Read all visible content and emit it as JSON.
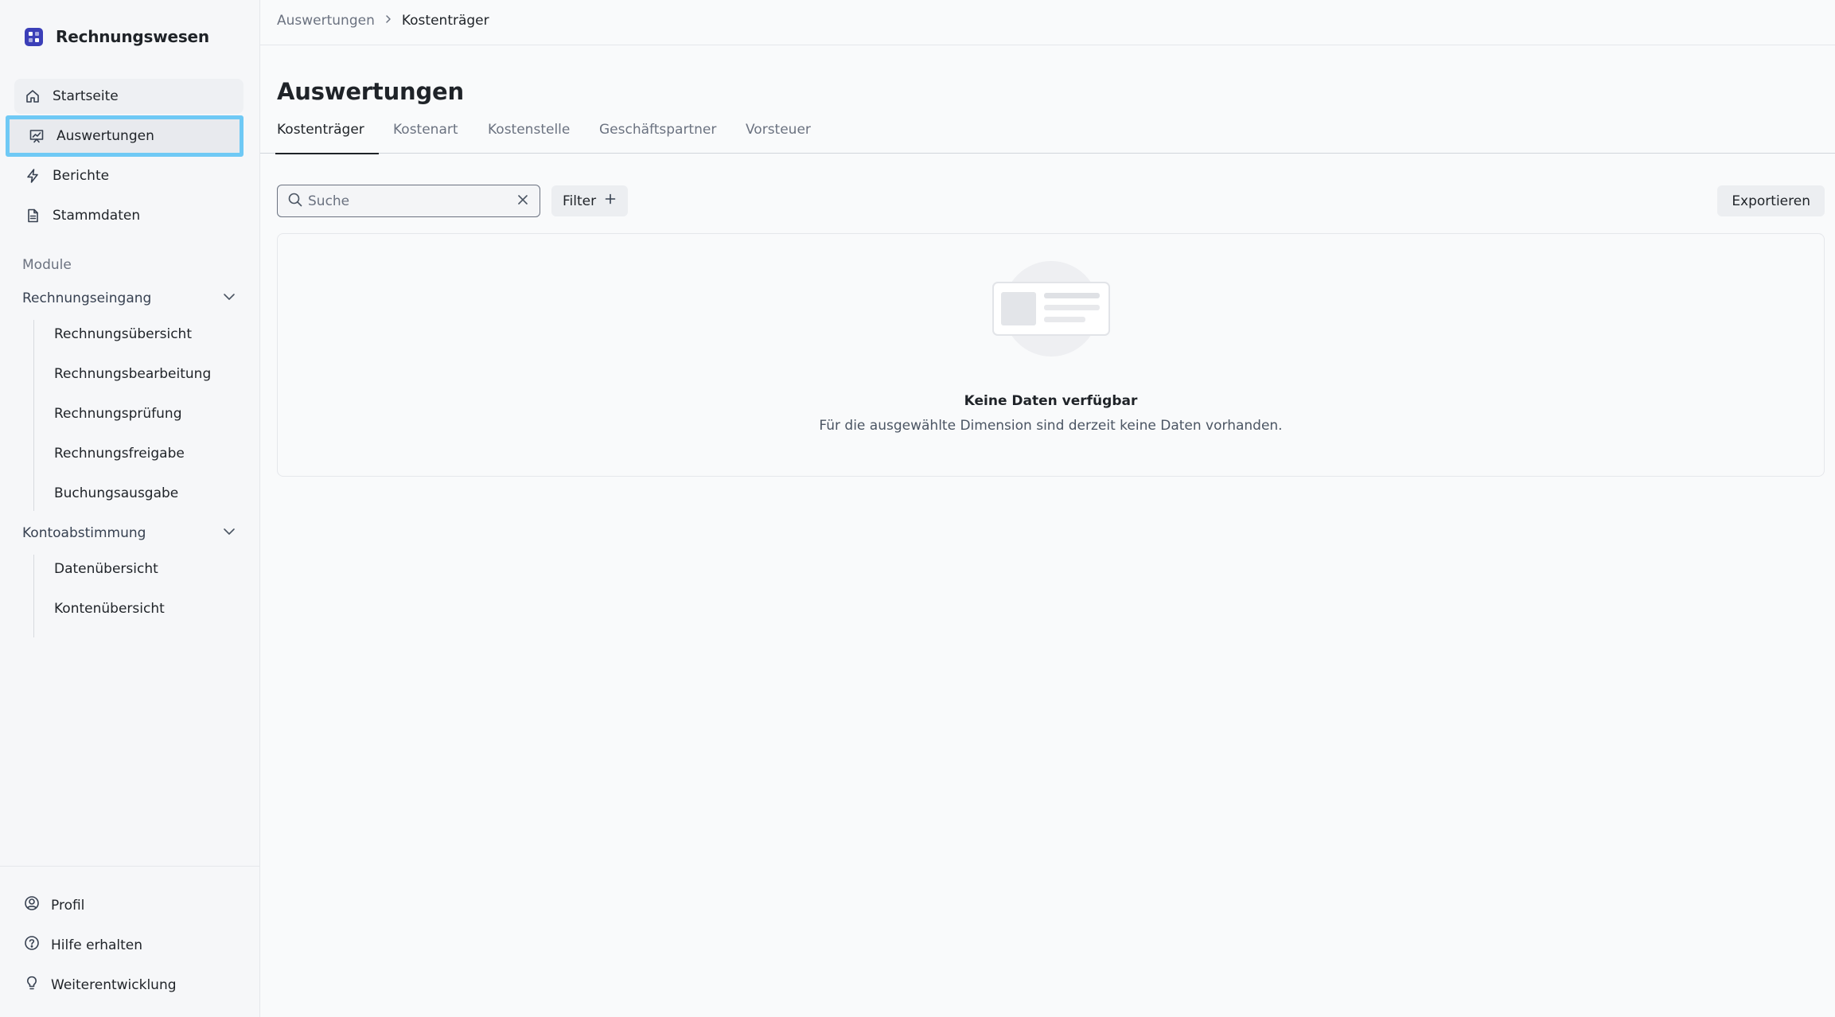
{
  "brand": {
    "name": "Rechnungswesen"
  },
  "nav": {
    "home": "Startseite",
    "analytics": "Auswertungen",
    "reports": "Berichte",
    "master_data": "Stammdaten"
  },
  "modules": {
    "label": "Module",
    "groups": [
      {
        "label": "Rechnungseingang",
        "items": [
          "Rechnungsübersicht",
          "Rechnungsbearbeitung",
          "Rechnungsprüfung",
          "Rechnungsfreigabe",
          "Buchungsausgabe"
        ]
      },
      {
        "label": "Kontoabstimmung",
        "items": [
          "Datenübersicht",
          "Kontenübersicht"
        ]
      }
    ]
  },
  "bottom_nav": {
    "profile": "Profil",
    "help": "Hilfe erhalten",
    "feedback": "Weiterentwicklung"
  },
  "breadcrumb": {
    "parent": "Auswertungen",
    "current": "Kostenträger"
  },
  "page": {
    "title": "Auswertungen"
  },
  "tabs": [
    "Kostenträger",
    "Kostenart",
    "Kostenstelle",
    "Geschäftspartner",
    "Vorsteuer"
  ],
  "active_tab": "Kostenträger",
  "toolbar": {
    "search_placeholder": "Suche",
    "search_value": "",
    "filter_label": "Filter",
    "export_label": "Exportieren"
  },
  "empty_state": {
    "title": "Keine Daten verfügbar",
    "description": "Für die ausgewählte Dimension sind derzeit keine Daten vorhanden."
  },
  "colors": {
    "brand": "#3b3fb8",
    "highlight": "#6fc9f5"
  }
}
